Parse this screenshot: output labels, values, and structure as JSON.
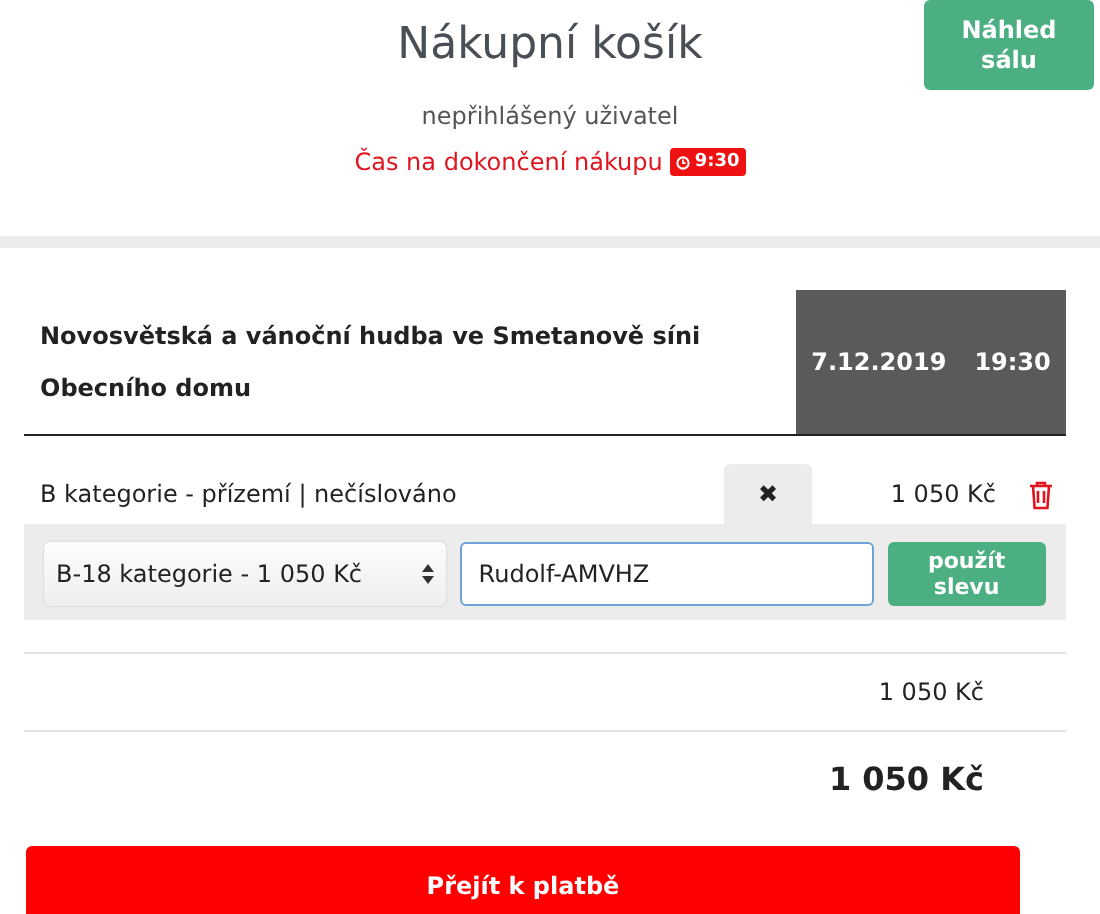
{
  "header": {
    "title": "Nákupní košík",
    "user": "nepřihlášený uživatel",
    "timer_label": "Čas na dokončení nákupu",
    "timer": "9:30",
    "hall_button": "Náhled sálu"
  },
  "event": {
    "name": "Novosvětská a vánoční hudba ve Smetanově síni Obecního domu",
    "date": "7.12.2019",
    "time": "19:30"
  },
  "tickets": [
    {
      "label": "B kategorie - přízemí | nečíslováno",
      "remove": "✖",
      "price": "1 050 Kč",
      "discount": {
        "category": "B-18 kategorie - 1 050 Kč",
        "code": "Rudolf-AMVHZ",
        "apply": "použít slevu"
      }
    }
  ],
  "subtotal": "1 050 Kč",
  "total": "1 050 Kč",
  "pay_button": "Přejít k platbě"
}
